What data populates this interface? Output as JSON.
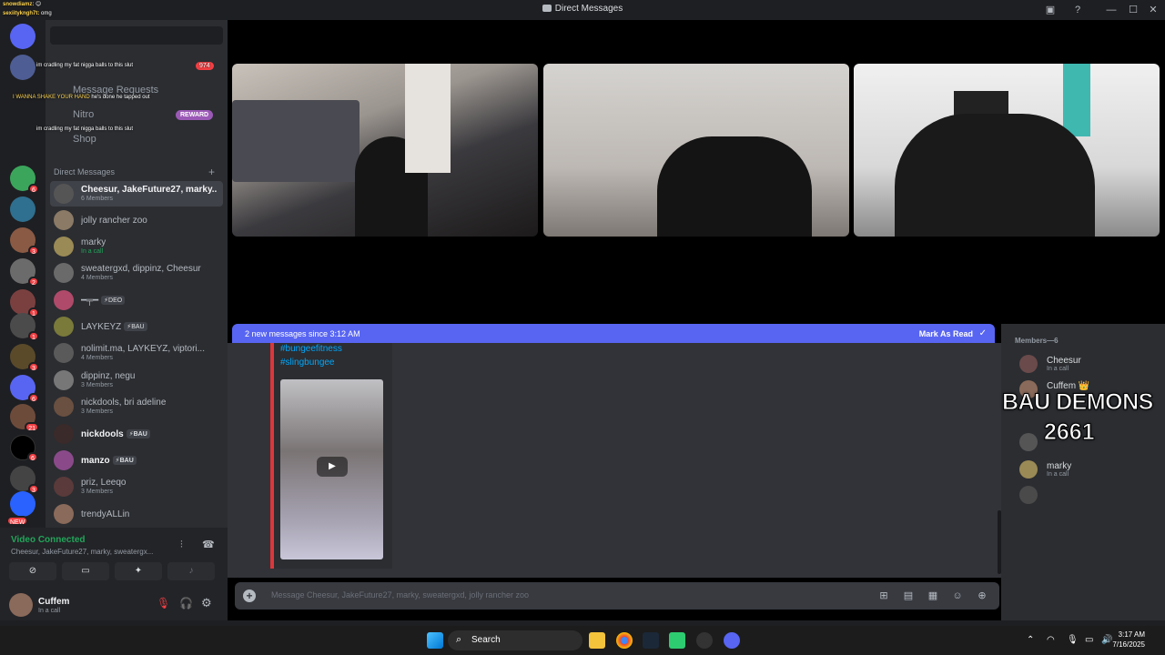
{
  "window": {
    "title": "Direct Messages"
  },
  "nav": {
    "message_requests": "Message Requests",
    "nitro": "Nitro",
    "nitro_badge": "REWARD",
    "shop": "Shop",
    "dm_header": "Direct Messages",
    "add_dm": "+"
  },
  "stream_overlay": {
    "chat_lines": [
      {
        "user": "snowdiamz:",
        "text": "😊"
      },
      {
        "user": "sexiitykngh7t:",
        "text": "omg"
      },
      {
        "user": "",
        "text": "im cradling my fat nigga balls to this slut"
      },
      {
        "user": "",
        "text": "I WANNA SHAKE YOUR HAND"
      },
      {
        "user": "",
        "text": "he's done he tapped out"
      },
      {
        "user": "",
        "text": "im cradling my fat nigga balls to this slut"
      }
    ],
    "chat_badge": "974",
    "title": "BAU DEMONS",
    "count": "2661"
  },
  "dms": [
    {
      "name": "Cheesur, JakeFuture27, marky...",
      "sub": "6 Members",
      "active": true
    },
    {
      "name": "jolly rancher zoo",
      "sub": ""
    },
    {
      "name": "marky",
      "sub": "In a call"
    },
    {
      "name": "sweatergxd, dippinz, Cheesur",
      "sub": "4 Members"
    },
    {
      "name": "━╤━",
      "sub": "",
      "tag": "⚡DEO"
    },
    {
      "name": "LAYKEYZ",
      "sub": "",
      "tag": "⚡BAU"
    },
    {
      "name": "nolimit.ma, LAYKEYZ, viptori...",
      "sub": "4 Members"
    },
    {
      "name": "dippinz, negu",
      "sub": "3 Members"
    },
    {
      "name": "nickdools, bri adeline",
      "sub": "3 Members"
    },
    {
      "name": "nickdools",
      "sub": "",
      "tag": "⚡BAU",
      "bold": true
    },
    {
      "name": "manzo",
      "sub": "",
      "tag": "⚡BAU",
      "bold": true
    },
    {
      "name": "priz, Leeqo",
      "sub": "3 Members"
    },
    {
      "name": "trendyALLin",
      "sub": ""
    }
  ],
  "server_badges": [
    "",
    "6",
    "",
    "3",
    "2",
    "1",
    "1",
    "3",
    "6",
    "3",
    "21",
    "",
    "6",
    "3",
    "NEW"
  ],
  "voice": {
    "status": "Video Connected",
    "channel": "Cheesur, JakeFuture27, marky, sweatergx...",
    "buttons": [
      "video-off",
      "screen-share",
      "activity",
      "soundboard"
    ]
  },
  "user": {
    "name": "Cuffem",
    "status": "In a call"
  },
  "banner": {
    "text": "2 new messages since 3:12 AM",
    "mark_read": "Mark As Read"
  },
  "message": {
    "hashtags": [
      "#bungeefitness",
      "#slingbungee"
    ]
  },
  "composer": {
    "placeholder": "Message Cheesur, JakeFuture27, marky, sweatergxd, jolly rancher zoo"
  },
  "members": {
    "header": "Members—6",
    "list": [
      {
        "name": "Cheesur",
        "status": "In a call"
      },
      {
        "name": "Cuffem 👑",
        "status": ""
      },
      {
        "name": "",
        "status": ""
      },
      {
        "name": "",
        "status": ""
      },
      {
        "name": "marky",
        "status": "In a call"
      },
      {
        "name": "",
        "status": ""
      }
    ]
  },
  "taskbar": {
    "search": "Search",
    "time": "3:17 AM",
    "date": "7/16/2025"
  },
  "colors": {
    "blurple": "#5865f2",
    "green": "#23a55a",
    "red": "#f23f43",
    "sidebar": "#2b2d31",
    "chat": "#313338"
  }
}
